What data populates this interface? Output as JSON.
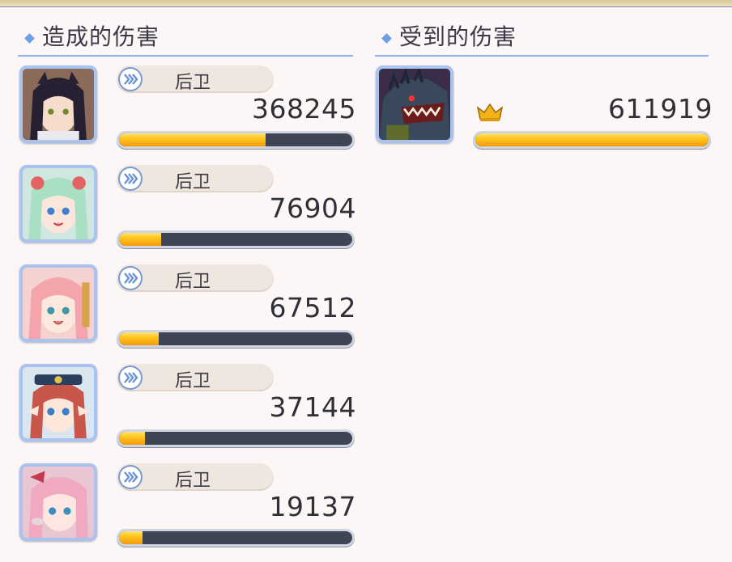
{
  "sections": {
    "dealt_title": "造成的伤害",
    "received_title": "受到的伤害"
  },
  "dealt": [
    {
      "role": "后卫",
      "damage": "368245",
      "fill": 0.63,
      "portrait": "dark-haired-girl-portrait"
    },
    {
      "role": "后卫",
      "damage": "76904",
      "fill": 0.18,
      "portrait": "green-haired-girl-portrait"
    },
    {
      "role": "后卫",
      "damage": "67512",
      "fill": 0.17,
      "portrait": "pink-haired-girl-portrait"
    },
    {
      "role": "后卫",
      "damage": "37144",
      "fill": 0.11,
      "portrait": "red-haired-elf-portrait"
    },
    {
      "role": "后卫",
      "damage": "19137",
      "fill": 0.1,
      "portrait": "pink-haired-girl-2-portrait"
    }
  ],
  "received": [
    {
      "damage": "611919",
      "fill": 1.0,
      "portrait": "dragon-boss-portrait",
      "icon": "crown-icon"
    }
  ],
  "colors": {
    "bar_fill": "#f7a712",
    "bar_track": "#3f4553",
    "header_line": "#8fb3e8",
    "accent_diamond": "#6d9fe6"
  }
}
